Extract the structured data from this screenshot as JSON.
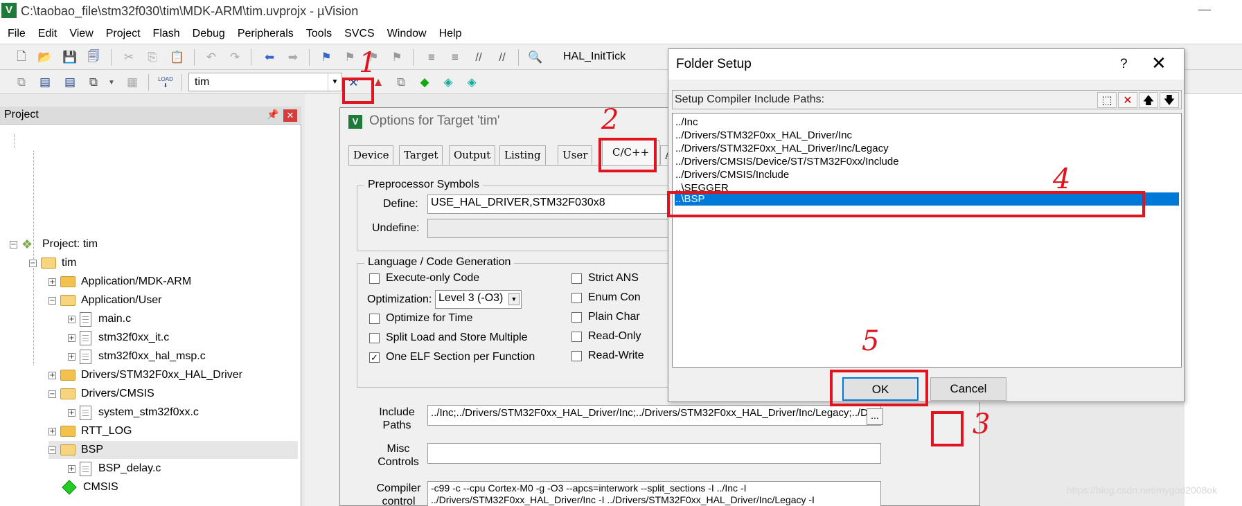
{
  "window": {
    "title": "C:\\taobao_file\\stm32f030\\tim\\MDK-ARM\\tim.uvprojx - µVision",
    "icon": "V"
  },
  "menu": [
    "File",
    "Edit",
    "View",
    "Project",
    "Flash",
    "Debug",
    "Peripherals",
    "Tools",
    "SVCS",
    "Window",
    "Help"
  ],
  "toolbar": {
    "function_label": "HAL_InitTick",
    "target": "tim",
    "load_label": "LOAD"
  },
  "project": {
    "title": "Project",
    "root": "Project: tim",
    "target": "tim",
    "items": [
      {
        "label": "Application/MDK-ARM",
        "kind": "folder",
        "level": 2,
        "expanded": false
      },
      {
        "label": "Application/User",
        "kind": "folder",
        "level": 2,
        "expanded": true
      },
      {
        "label": "main.c",
        "kind": "file",
        "level": 3
      },
      {
        "label": "stm32f0xx_it.c",
        "kind": "file",
        "level": 3
      },
      {
        "label": "stm32f0xx_hal_msp.c",
        "kind": "file",
        "level": 3
      },
      {
        "label": "Drivers/STM32F0xx_HAL_Driver",
        "kind": "folder",
        "level": 2,
        "expanded": false
      },
      {
        "label": "Drivers/CMSIS",
        "kind": "folder",
        "level": 2,
        "expanded": true
      },
      {
        "label": "system_stm32f0xx.c",
        "kind": "file",
        "level": 3
      },
      {
        "label": "RTT_LOG",
        "kind": "folder",
        "level": 2,
        "expanded": false
      },
      {
        "label": "BSP",
        "kind": "folder",
        "level": 2,
        "expanded": true
      },
      {
        "label": "BSP_delay.c",
        "kind": "file",
        "level": 3
      },
      {
        "label": "CMSIS",
        "kind": "component",
        "level": 2
      }
    ]
  },
  "options": {
    "title": "Options for Target 'tim'",
    "tabs": [
      "Device",
      "Target",
      "Output",
      "Listing",
      "User",
      "C/C++",
      "A"
    ],
    "active_tab": "C/C++",
    "preprocessor": {
      "group": "Preprocessor Symbols",
      "define_label": "Define:",
      "define_value": "USE_HAL_DRIVER,STM32F030x8",
      "undefine_label": "Undefine:",
      "undefine_value": ""
    },
    "codegen": {
      "group": "Language / Code Generation",
      "execute_only": "Execute-only Code",
      "optimization_label": "Optimization:",
      "optimization_value": "Level 3 (-O3)",
      "optimize_time": "Optimize for Time",
      "split_load": "Split Load and Store Multiple",
      "one_elf": "One ELF Section per Function",
      "strict_ansi": "Strict ANS",
      "enum_container": "Enum Con",
      "plain_char": "Plain Char",
      "read_only": "Read-Only",
      "read_write": "Read-Write"
    },
    "include": {
      "label_line1": "Include",
      "label_line2": "Paths",
      "value": "../Inc;../Drivers/STM32F0xx_HAL_Driver/Inc;../Drivers/STM32F0xx_HAL_Driver/Inc/Legacy;../Driv",
      "button": "..."
    },
    "misc": {
      "label_line1": "Misc",
      "label_line2": "Controls",
      "value": ""
    },
    "compiler": {
      "label_line1": "Compiler",
      "label_line2": "control",
      "line1": "-c99 -c --cpu Cortex-M0 -g -O3 --apcs=interwork --split_sections -I ../Inc -I",
      "line2": "../Drivers/STM32F0xx_HAL_Driver/Inc -I ../Drivers/STM32F0xx_HAL_Driver/Inc/Legacy -I"
    }
  },
  "folder_setup": {
    "title": "Folder Setup",
    "help": "?",
    "close": "✕",
    "header": "Setup Compiler Include Paths:",
    "paths": [
      "../Inc",
      "../Drivers/STM32F0xx_HAL_Driver/Inc",
      "../Drivers/STM32F0xx_HAL_Driver/Inc/Legacy",
      "../Drivers/CMSIS/Device/ST/STM32F0xx/Include",
      "../Drivers/CMSIS/Include",
      "..\\SEGGER",
      "..\\BSP"
    ],
    "selected_index": 6,
    "ok": "OK",
    "cancel": "Cancel"
  },
  "annotations": [
    "1",
    "2",
    "3",
    "4",
    "5"
  ],
  "watermark": "https://blog.csdn.net/mygod2008ok",
  "colors": {
    "highlight": "#0078d7",
    "annotation": "#e0141e"
  }
}
